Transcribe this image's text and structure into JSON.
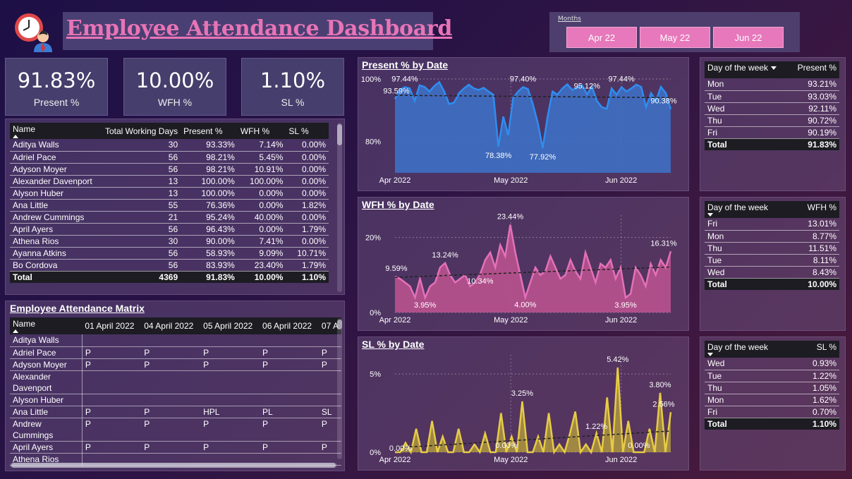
{
  "header": {
    "title": "Employee Attendance Dashboard",
    "logo_icon": "clock-person-icon"
  },
  "months_slicer": {
    "label": "Months",
    "options": [
      "Apr 22",
      "May 22",
      "Jun 22"
    ]
  },
  "kpis": [
    {
      "value": "91.83%",
      "label": "Present %"
    },
    {
      "value": "10.00%",
      "label": "WFH %"
    },
    {
      "value": "1.10%",
      "label": "SL %"
    }
  ],
  "employee_table": {
    "columns": [
      "Name",
      "Total Working Days",
      "Present %",
      "WFH %",
      "SL %"
    ],
    "rows": [
      [
        "Aditya Walls",
        "30",
        "93.33%",
        "7.14%",
        "0.00%"
      ],
      [
        "Adriel Pace",
        "56",
        "98.21%",
        "5.45%",
        "0.00%"
      ],
      [
        "Adyson Moyer",
        "56",
        "98.21%",
        "10.91%",
        "0.00%"
      ],
      [
        "Alexander Davenport",
        "13",
        "100.00%",
        "100.00%",
        "0.00%"
      ],
      [
        "Alyson Huber",
        "13",
        "100.00%",
        "0.00%",
        "0.00%"
      ],
      [
        "Ana Little",
        "55",
        "76.36%",
        "0.00%",
        "1.82%"
      ],
      [
        "Andrew Cummings",
        "21",
        "95.24%",
        "40.00%",
        "0.00%"
      ],
      [
        "April Ayers",
        "56",
        "96.43%",
        "0.00%",
        "1.79%"
      ],
      [
        "Athena Rios",
        "30",
        "90.00%",
        "7.41%",
        "0.00%"
      ],
      [
        "Ayanna Atkins",
        "56",
        "58.93%",
        "9.09%",
        "10.71%"
      ],
      [
        "Bo Cordova",
        "56",
        "83.93%",
        "23.40%",
        "1.79%"
      ]
    ],
    "total": [
      "Total",
      "4369",
      "91.83%",
      "10.00%",
      "1.10%"
    ]
  },
  "matrix": {
    "title": "Employee Attendance Matrix",
    "columns": [
      "Name",
      "01 April 2022",
      "04 April 2022",
      "05 April 2022",
      "06 April 2022",
      "07 A"
    ],
    "rows": [
      [
        "Aditya Walls",
        "",
        "",
        "",
        "",
        ""
      ],
      [
        "Adriel Pace",
        "P",
        "P",
        "P",
        "P",
        "P"
      ],
      [
        "Adyson Moyer",
        "P",
        "P",
        "P",
        "P",
        "P"
      ],
      [
        "Alexander Davenport",
        "",
        "",
        "",
        "",
        ""
      ],
      [
        "Alyson Huber",
        "",
        "",
        "",
        "",
        ""
      ],
      [
        "Ana Little",
        "P",
        "P",
        "HPL",
        "PL",
        "SL"
      ],
      [
        "Andrew Cummings",
        "P",
        "P",
        "P",
        "P",
        "P"
      ],
      [
        "April Ayers",
        "P",
        "P",
        "P",
        "P",
        "P"
      ],
      [
        "Athena Rios",
        "",
        "",
        "",
        "",
        ""
      ]
    ]
  },
  "charts": [
    {
      "title": "Present % by Date",
      "chart_data": {
        "type": "area",
        "title": "Present % by Date",
        "color": "#2f8df0",
        "fill": "#3e6fc4",
        "y_ticks": [
          "100%",
          "80%"
        ],
        "y_tick_values": [
          100,
          80
        ],
        "ylim": [
          70,
          100
        ],
        "x_ticks": [
          "Apr 2022",
          "May 2022",
          "Jun 2022"
        ],
        "values": [
          93.6,
          96.5,
          97.4,
          97.0,
          93.0,
          98.0,
          97.5,
          96.0,
          97.8,
          99.0,
          96.0,
          92.0,
          92.5,
          95.5,
          97.0,
          98.2,
          97.0,
          96.5,
          97.2,
          96.0,
          95.0,
          78.4,
          88.0,
          82.0,
          94.0,
          96.0,
          97.4,
          96.8,
          92.0,
          86.0,
          77.9,
          88.0,
          96.0,
          95.0,
          97.0,
          98.3,
          96.5,
          97.2,
          98.0,
          95.1,
          97.5,
          93.0,
          91.0,
          90.5,
          97.0,
          95.0,
          97.4,
          96.0,
          97.0,
          98.2,
          97.5,
          91.0,
          95.5,
          93.0,
          97.5,
          95.5,
          90.4
        ],
        "labels": [
          {
            "i": 0,
            "text": "93.59%"
          },
          {
            "i": 2,
            "text": "97.44%"
          },
          {
            "i": 21,
            "text": "78.38%"
          },
          {
            "i": 26,
            "text": "97.40%"
          },
          {
            "i": 30,
            "text": "77.92%"
          },
          {
            "i": 39,
            "text": "95.12%"
          },
          {
            "i": 46,
            "text": "97.44%"
          },
          {
            "i": 56,
            "text": "90.38%"
          }
        ]
      }
    },
    {
      "title": "WFH % by Date",
      "chart_data": {
        "type": "area",
        "title": "WFH % by Date",
        "color": "#e371b7",
        "fill": "#b9528f",
        "y_ticks": [
          "20%",
          "0%"
        ],
        "y_tick_values": [
          20,
          0
        ],
        "ylim": [
          0,
          25
        ],
        "x_ticks": [
          "Apr 2022",
          "May 2022",
          "Jun 2022"
        ],
        "values": [
          9.6,
          9.0,
          8.0,
          7.0,
          4.0,
          9.0,
          3.95,
          7.0,
          8.0,
          12.0,
          13.2,
          10.0,
          8.0,
          9.0,
          10.0,
          7.0,
          8.0,
          10.3,
          14.0,
          16.0,
          12.0,
          18.0,
          15.0,
          23.4,
          16.0,
          10.0,
          4.0,
          8.0,
          12.0,
          10.0,
          11.0,
          15.0,
          12.0,
          9.0,
          10.0,
          14.0,
          11.0,
          9.0,
          16.0,
          12.0,
          8.0,
          13.0,
          12.0,
          14.0,
          9.0,
          12.0,
          3.95,
          5.0,
          12.0,
          10.0,
          7.0,
          13.0,
          10.0,
          14.0,
          12.0,
          16.3
        ],
        "labels": [
          {
            "i": 0,
            "text": "9.59%"
          },
          {
            "i": 6,
            "text": "3.95%"
          },
          {
            "i": 10,
            "text": "13.24%"
          },
          {
            "i": 17,
            "text": "10.34%"
          },
          {
            "i": 23,
            "text": "23.44%"
          },
          {
            "i": 26,
            "text": "4.00%"
          },
          {
            "i": 46,
            "text": "3.95%"
          },
          {
            "i": 55,
            "text": "16.31%"
          }
        ]
      }
    },
    {
      "title": "SL % by Date",
      "chart_data": {
        "type": "area",
        "title": "SL % by Date",
        "color": "#e7cc45",
        "fill": "#a89141",
        "y_ticks": [
          "5%",
          "0%"
        ],
        "y_tick_values": [
          5,
          0
        ],
        "ylim": [
          0,
          6
        ],
        "x_ticks": [
          "Apr 2022",
          "May 2022",
          "Jun 2022"
        ],
        "values": [
          0.0,
          0.0,
          0.6,
          0.0,
          1.5,
          0.0,
          0.0,
          2.0,
          0.0,
          1.0,
          0.0,
          0.0,
          1.5,
          0.0,
          0.0,
          0.5,
          0.0,
          1.2,
          0.0,
          0.0,
          2.5,
          0.0,
          1.0,
          0.0,
          3.25,
          0.0,
          0.0,
          1.0,
          0.0,
          2.5,
          0.0,
          0.5,
          0.0,
          1.2,
          2.6,
          0.0,
          0.5,
          0.0,
          1.22,
          0.0,
          3.5,
          0.0,
          5.42,
          0.0,
          2.0,
          0.0,
          0.0,
          0.0,
          1.5,
          0.0,
          3.8,
          0.0,
          2.56
        ],
        "labels": [
          {
            "i": 1,
            "text": "0.00%"
          },
          {
            "i": 21,
            "text": "0.00%"
          },
          {
            "i": 24,
            "text": "3.25%"
          },
          {
            "i": 38,
            "text": "1.22%"
          },
          {
            "i": 42,
            "text": "5.42%"
          },
          {
            "i": 46,
            "text": "0.00%"
          },
          {
            "i": 50,
            "text": "3.80%"
          },
          {
            "i": 52,
            "text": "2.56%"
          }
        ]
      }
    }
  ],
  "dow_tables": [
    {
      "header": [
        "Day of the week",
        "Present %"
      ],
      "rows": [
        [
          "Mon",
          "93.21%"
        ],
        [
          "Tue",
          "93.03%"
        ],
        [
          "Wed",
          "92.11%"
        ],
        [
          "Thu",
          "90.72%"
        ],
        [
          "Fri",
          "90.19%"
        ]
      ],
      "total": [
        "Total",
        "91.83%"
      ]
    },
    {
      "header": [
        "Day of the week",
        "WFH %"
      ],
      "rows": [
        [
          "Fri",
          "13.01%"
        ],
        [
          "Mon",
          "8.77%"
        ],
        [
          "Thu",
          "11.51%"
        ],
        [
          "Tue",
          "8.11%"
        ],
        [
          "Wed",
          "8.43%"
        ]
      ],
      "total": [
        "Total",
        "10.00%"
      ]
    },
    {
      "header": [
        "Day of the week",
        "SL %"
      ],
      "rows": [
        [
          "Wed",
          "0.93%"
        ],
        [
          "Tue",
          "1.22%"
        ],
        [
          "Thu",
          "1.05%"
        ],
        [
          "Mon",
          "1.62%"
        ],
        [
          "Fri",
          "0.70%"
        ]
      ],
      "total": [
        "Total",
        "1.10%"
      ]
    }
  ]
}
